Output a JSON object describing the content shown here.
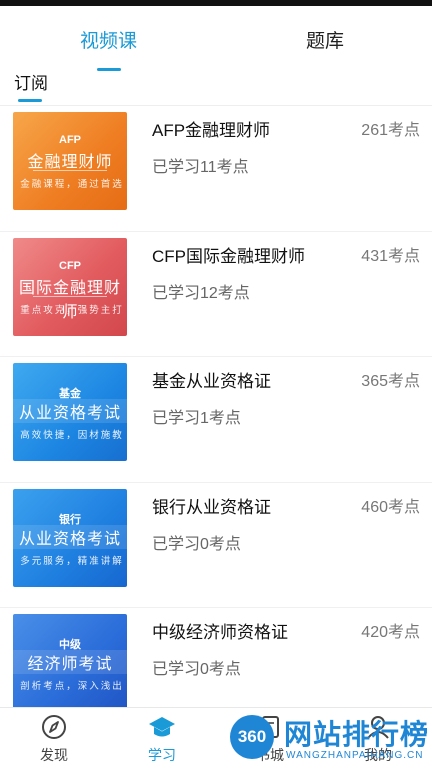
{
  "tabs": [
    {
      "label": "视频课",
      "active": true
    },
    {
      "label": "题库",
      "active": false
    }
  ],
  "subtab": {
    "label": "订阅"
  },
  "courses": [
    {
      "thumb_tag": "AFP",
      "thumb_title": "金融理财师",
      "thumb_sub": "金融课程，通过首选",
      "title": "AFP金融理财师",
      "count": "261考点",
      "progress": "已学习11考点"
    },
    {
      "thumb_tag": "CFP",
      "thumb_title": "国际金融理财师",
      "thumb_sub": "重点攻克，强势主打",
      "title": "CFP国际金融理财师",
      "count": "431考点",
      "progress": "已学习12考点"
    },
    {
      "thumb_tag": "基金",
      "thumb_title": "从业资格考试",
      "thumb_sub": "高效快捷，因材施教",
      "title": "基金从业资格证",
      "count": "365考点",
      "progress": "已学习1考点"
    },
    {
      "thumb_tag": "银行",
      "thumb_title": "从业资格考试",
      "thumb_sub": "多元服务，精准讲解",
      "title": "银行从业资格证",
      "count": "460考点",
      "progress": "已学习0考点"
    },
    {
      "thumb_tag": "中级",
      "thumb_title": "经济师考试",
      "thumb_sub": "剖析考点，深入浅出",
      "title": "中级经济师资格证",
      "count": "420考点",
      "progress": "已学习0考点"
    }
  ],
  "nav": [
    {
      "label": "发现",
      "icon": "compass-icon",
      "active": false
    },
    {
      "label": "学习",
      "icon": "graduation-cap-icon",
      "active": true
    },
    {
      "label": "书城",
      "icon": "book-icon",
      "active": false
    },
    {
      "label": "我的",
      "icon": "user-icon",
      "active": false
    }
  ],
  "watermark": {
    "badge": "360",
    "text": "网站排行榜",
    "url": "WANGZHANPAIHANG.CN"
  },
  "colors": {
    "accent": "#1a9ad6"
  }
}
